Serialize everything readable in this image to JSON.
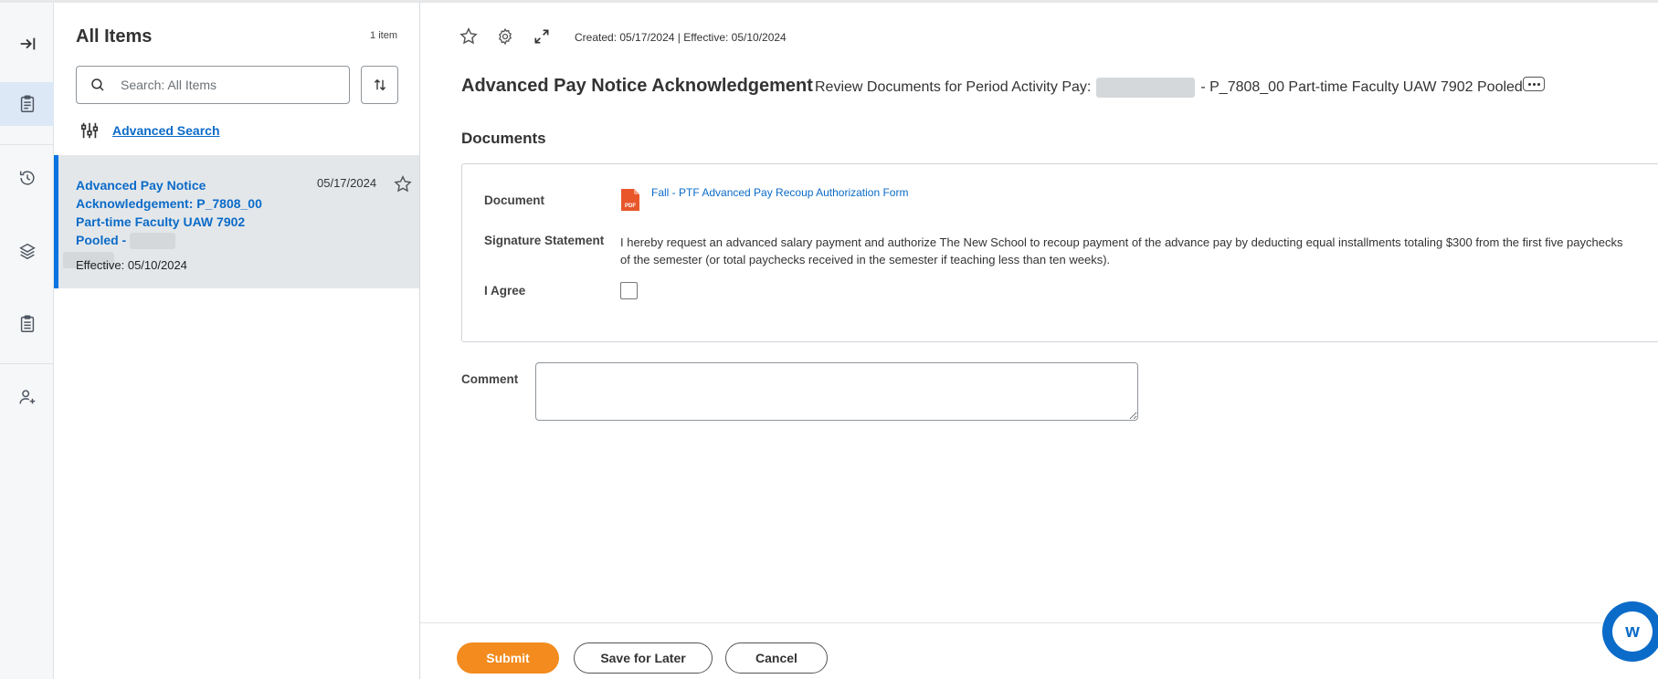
{
  "list": {
    "title": "All Items",
    "count": "1 item",
    "search_placeholder": "Search: All Items",
    "advanced_search": "Advanced Search",
    "items": [
      {
        "title": "Advanced Pay Notice Acknowledgement: P_7808_00 Part-time Faculty UAW 7902 Pooled -",
        "date": "05/17/2024",
        "effective": "Effective: 05/10/2024"
      }
    ]
  },
  "main": {
    "created": "Created: 05/17/2024 | Effective: 05/10/2024",
    "title": "Advanced Pay Notice Acknowledgement",
    "subtitle_prefix": "Review Documents for Period Activity Pay:",
    "subtitle_suffix": "- P_7808_00 Part-time Faculty UAW 7902 Pooled",
    "section_title": "Documents",
    "document_label": "Document",
    "document_link": "Fall - PTF Advanced Pay Recoup Authorization Form",
    "pdf_label": "PDF",
    "signature_label": "Signature Statement",
    "signature_text": "I hereby request an advanced salary payment and authorize The New School to recoup payment of the advance pay by deducting equal installments totaling $300 from the first five paychecks of the semester (or total paychecks received in the semester if teaching less than ten weeks).",
    "agree_label": "I Agree",
    "comment_label": "Comment"
  },
  "footer": {
    "submit": "Submit",
    "save_for_later": "Save for Later",
    "cancel": "Cancel"
  },
  "assistant": {
    "glyph": "w"
  },
  "colors": {
    "accent": "#0875e1",
    "link": "#0b6bc8",
    "primary_button": "#f38b1e",
    "selected_item_bg": "#e4e7ea"
  },
  "icons": {
    "rail": [
      "expand-panel-icon",
      "inbox-icon",
      "history-icon",
      "layers-icon",
      "clipboard-icon",
      "add-person-icon"
    ],
    "toolbar": [
      "star-icon",
      "gear-icon",
      "fullscreen-icon"
    ]
  }
}
